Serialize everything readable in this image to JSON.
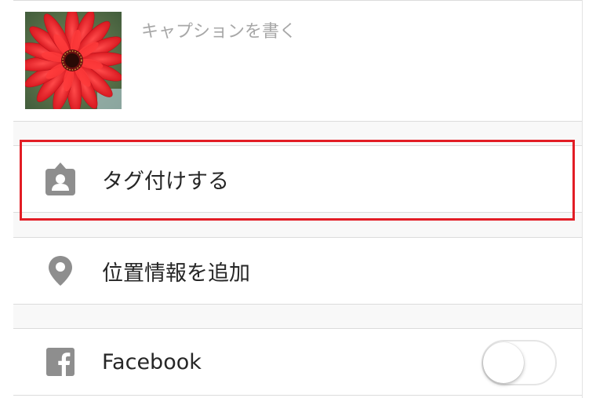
{
  "composer": {
    "caption_placeholder": "キャプションを書く"
  },
  "options": {
    "tag_people": {
      "label": "タグ付けする",
      "icon": "tag-person-icon"
    },
    "add_location": {
      "label": "位置情報を追加",
      "icon": "location-pin-icon"
    }
  },
  "share": {
    "facebook": {
      "label": "Facebook",
      "icon": "facebook-icon",
      "enabled": false
    }
  },
  "colors": {
    "highlight": "#e21d25",
    "icon_gray": "#8e8e8e",
    "text": "#262626",
    "placeholder": "#a7a7a7"
  }
}
